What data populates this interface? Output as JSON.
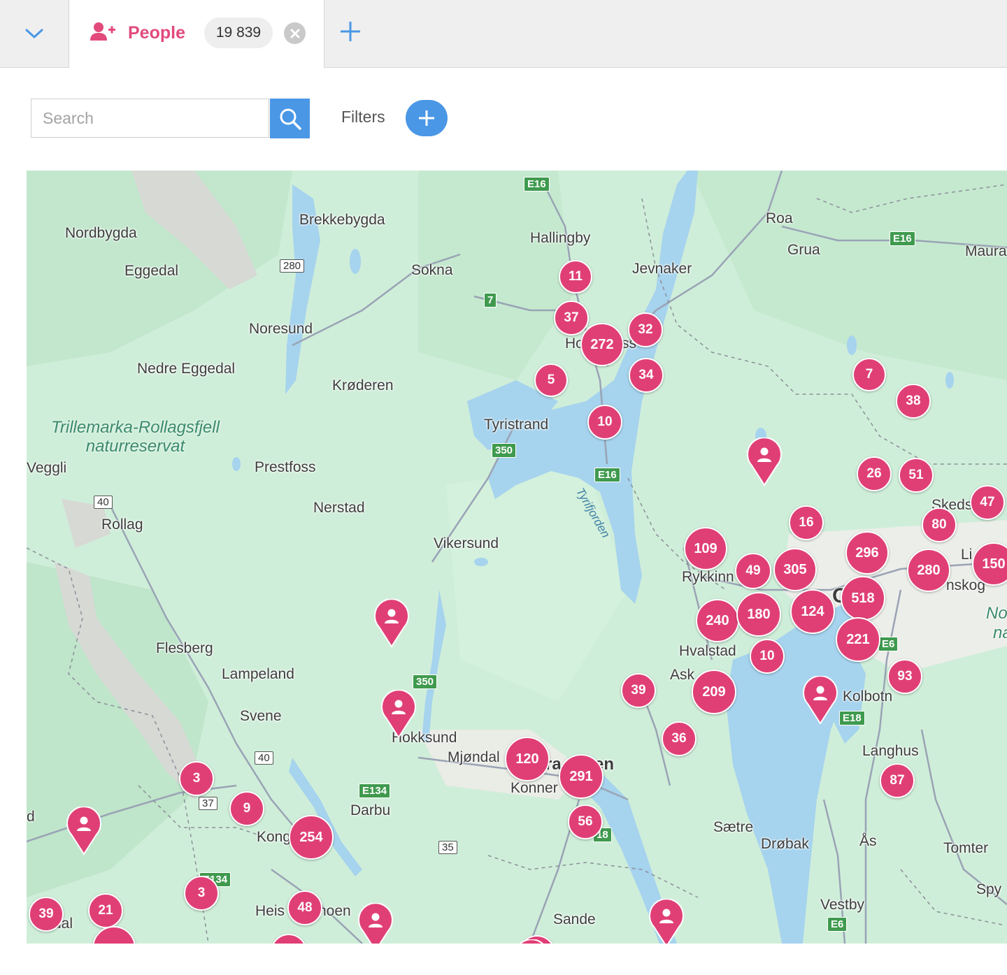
{
  "tabs": {
    "active_label": "People",
    "count": "19 839"
  },
  "toolbar": {
    "search_placeholder": "Search",
    "filters_label": "Filters"
  },
  "colors": {
    "accent_pink": "#e03f76",
    "accent_blue": "#4a97e6"
  },
  "map": {
    "places": [
      {
        "name": "Nordbygda"
      },
      {
        "name": "Eggedal"
      },
      {
        "name": "Brekkebygda"
      },
      {
        "name": "Sokna"
      },
      {
        "name": "Hallingby"
      },
      {
        "name": "Jevnaker"
      },
      {
        "name": "Roa"
      },
      {
        "name": "Grua"
      },
      {
        "name": "Maura"
      },
      {
        "name": "Noresund"
      },
      {
        "name": "Nedre Eggedal"
      },
      {
        "name": "Krøderen"
      },
      {
        "name": "Tyristrand"
      },
      {
        "name": "Veggli"
      },
      {
        "name": "Prestfoss"
      },
      {
        "name": "Rollag"
      },
      {
        "name": "Nerstad"
      },
      {
        "name": "Vikersund"
      },
      {
        "name": "Rykkinn"
      },
      {
        "name": "Skeds"
      },
      {
        "name": "Flesberg"
      },
      {
        "name": "Lampeland"
      },
      {
        "name": "Hvalstad"
      },
      {
        "name": "Ask"
      },
      {
        "name": "Svene"
      },
      {
        "name": "Hokksund"
      },
      {
        "name": "Kolbotn"
      },
      {
        "name": "Mjøndal"
      },
      {
        "name": "Konner"
      },
      {
        "name": "Langhus"
      },
      {
        "name": "Darbu"
      },
      {
        "name": "Kong"
      },
      {
        "name": "Sætre"
      },
      {
        "name": "Drøbak"
      },
      {
        "name": "Ås"
      },
      {
        "name": "Tomter"
      },
      {
        "name": "Heis"
      },
      {
        "name": "hoen"
      },
      {
        "name": "Sande"
      },
      {
        "name": "Vestby"
      },
      {
        "name": "Spy"
      },
      {
        "name": "d"
      },
      {
        "name": "dal"
      },
      {
        "name": "Li"
      },
      {
        "name": "nskog"
      },
      {
        "name": "No"
      },
      {
        "name": "na"
      },
      {
        "name": "Os"
      },
      {
        "name": "en"
      },
      {
        "name": "ss"
      },
      {
        "name": "Ho"
      },
      {
        "name": "ra"
      }
    ],
    "reserve_label": "Trillemarka-Rollagsfjell\nnaturreservat",
    "water_label": "Tyrifjorden",
    "road_shields": [
      {
        "label": "E16",
        "type": "green"
      },
      {
        "label": "E16",
        "type": "green"
      },
      {
        "label": "E16",
        "type": "green"
      },
      {
        "label": "7",
        "type": "green"
      },
      {
        "label": "350",
        "type": "green"
      },
      {
        "label": "350",
        "type": "green"
      },
      {
        "label": "E134",
        "type": "green"
      },
      {
        "label": "E134",
        "type": "green"
      },
      {
        "label": "E6",
        "type": "green"
      },
      {
        "label": "E6",
        "type": "green"
      },
      {
        "label": "E18",
        "type": "green"
      },
      {
        "label": "18",
        "type": "green"
      },
      {
        "label": "280",
        "type": "white"
      },
      {
        "label": "40",
        "type": "white"
      },
      {
        "label": "40",
        "type": "white"
      },
      {
        "label": "37",
        "type": "white"
      },
      {
        "label": "35",
        "type": "white"
      }
    ],
    "clusters": [
      "11",
      "37",
      "272",
      "32",
      "34",
      "5",
      "10",
      "7",
      "38",
      "26",
      "51",
      "47",
      "16",
      "80",
      "109",
      "296",
      "150",
      "49",
      "305",
      "280",
      "518",
      "240",
      "180",
      "124",
      "221",
      "10",
      "93",
      "39",
      "209",
      "36",
      "87",
      "120",
      "291",
      "56",
      "3",
      "9",
      "254",
      "3",
      "39",
      "21",
      "48"
    ],
    "person_pins": 8
  }
}
